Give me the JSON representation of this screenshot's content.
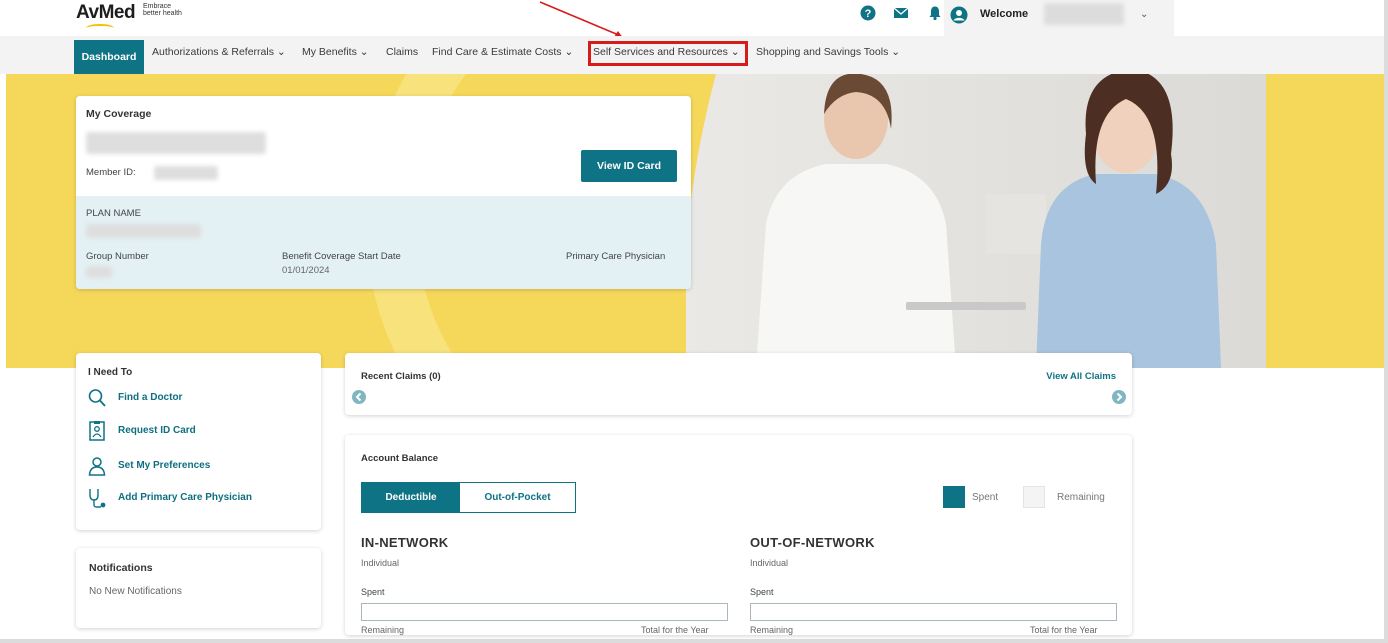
{
  "brand": {
    "name": "AvMed",
    "tagline": "Embrace better health"
  },
  "header": {
    "welcome": "Welcome"
  },
  "nav": {
    "items": [
      {
        "label": "Dashboard"
      },
      {
        "label": "Authorizations & Referrals"
      },
      {
        "label": "My Benefits"
      },
      {
        "label": "Claims"
      },
      {
        "label": "Find Care & Estimate Costs"
      },
      {
        "label": "Self Services and Resources"
      },
      {
        "label": "Shopping and Savings Tools"
      }
    ]
  },
  "coverage": {
    "title": "My Coverage",
    "member_id_label": "Member ID:",
    "view_id_button": "View ID Card",
    "plan_name_label": "PLAN NAME",
    "group_number_label": "Group Number",
    "start_date_label": "Benefit Coverage Start Date",
    "start_date_value": "01/01/2024",
    "pcp_label": "Primary Care Physician"
  },
  "ineed": {
    "title": "I Need To",
    "actions": [
      {
        "label": "Find a Doctor",
        "icon": "search-icon"
      },
      {
        "label": "Request ID Card",
        "icon": "id-card-icon"
      },
      {
        "label": "Set My Preferences",
        "icon": "user-icon"
      },
      {
        "label": "Add Primary Care Physician",
        "icon": "stethoscope-icon"
      }
    ]
  },
  "notifications": {
    "title": "Notifications",
    "empty": "No New Notifications"
  },
  "claims": {
    "title": "Recent Claims (0)",
    "view_all": "View All Claims"
  },
  "account": {
    "title": "Account Balance",
    "tabs": [
      {
        "label": "Deductible"
      },
      {
        "label": "Out-of-Pocket"
      }
    ],
    "legend": {
      "spent": "Spent",
      "remaining": "Remaining"
    },
    "in_network": {
      "title": "IN-NETWORK",
      "sub": "Individual",
      "spent": "Spent",
      "remaining": "Remaining",
      "total": "Total for the Year"
    },
    "out_network": {
      "title": "OUT-OF-NETWORK",
      "sub": "Individual",
      "spent": "Spent",
      "remaining": "Remaining",
      "total": "Total for the Year"
    }
  },
  "colors": {
    "accent": "#0e7384",
    "hero": "#f5d85a",
    "highlight": "#d81a1a"
  }
}
